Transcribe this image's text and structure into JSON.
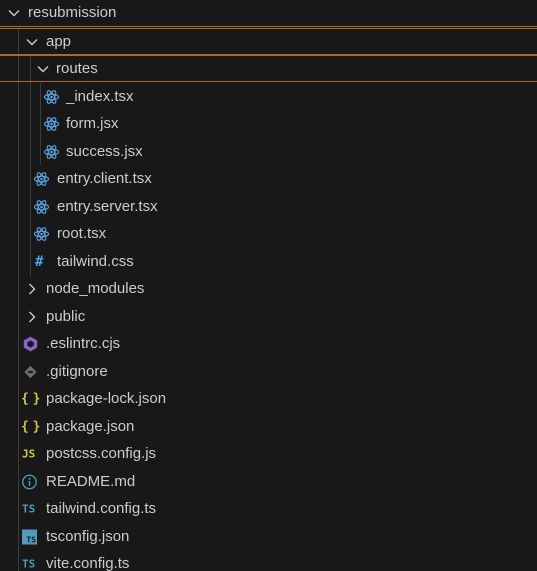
{
  "explorer": {
    "root": {
      "label": "resubmission",
      "expanded": true
    },
    "items": [
      {
        "label": "app",
        "type": "folder",
        "expanded": true
      },
      {
        "label": "routes",
        "type": "folder",
        "expanded": true
      },
      {
        "label": "_index.tsx",
        "type": "file",
        "icon": "react-icon"
      },
      {
        "label": "form.jsx",
        "type": "file",
        "icon": "react-icon"
      },
      {
        "label": "success.jsx",
        "type": "file",
        "icon": "react-icon"
      },
      {
        "label": "entry.client.tsx",
        "type": "file",
        "icon": "react-icon"
      },
      {
        "label": "entry.server.tsx",
        "type": "file",
        "icon": "react-icon"
      },
      {
        "label": "root.tsx",
        "type": "file",
        "icon": "react-icon"
      },
      {
        "label": "tailwind.css",
        "type": "file",
        "icon": "css-hash-icon",
        "glyph": "#"
      },
      {
        "label": "node_modules",
        "type": "folder",
        "expanded": false
      },
      {
        "label": "public",
        "type": "folder",
        "expanded": false
      },
      {
        "label": ".eslintrc.cjs",
        "type": "file",
        "icon": "eslint-icon"
      },
      {
        "label": ".gitignore",
        "type": "file",
        "icon": "git-icon"
      },
      {
        "label": "package-lock.json",
        "type": "file",
        "icon": "json-braces-icon",
        "glyph": "{ }"
      },
      {
        "label": "package.json",
        "type": "file",
        "icon": "json-braces-icon",
        "glyph": "{ }"
      },
      {
        "label": "postcss.config.js",
        "type": "file",
        "icon": "javascript-icon",
        "glyph": "JS"
      },
      {
        "label": "README.md",
        "type": "file",
        "icon": "info-icon"
      },
      {
        "label": "tailwind.config.ts",
        "type": "file",
        "icon": "typescript-icon",
        "glyph": "TS"
      },
      {
        "label": "tsconfig.json",
        "type": "file",
        "icon": "tsconfig-icon",
        "glyph": "TS"
      },
      {
        "label": "vite.config.ts",
        "type": "file",
        "icon": "typescript-icon",
        "glyph": "TS"
      }
    ]
  },
  "colors": {
    "background": "#181818",
    "text": "#cccccc",
    "focus_outline": "#b0691e",
    "react": "#5aa8e8",
    "css": "#42a5f5",
    "eslint": "#8d63c9",
    "json": "#d7c24a",
    "javascript": "#cbcb41",
    "typescript": "#519aba",
    "git": "#6d6d6d"
  }
}
